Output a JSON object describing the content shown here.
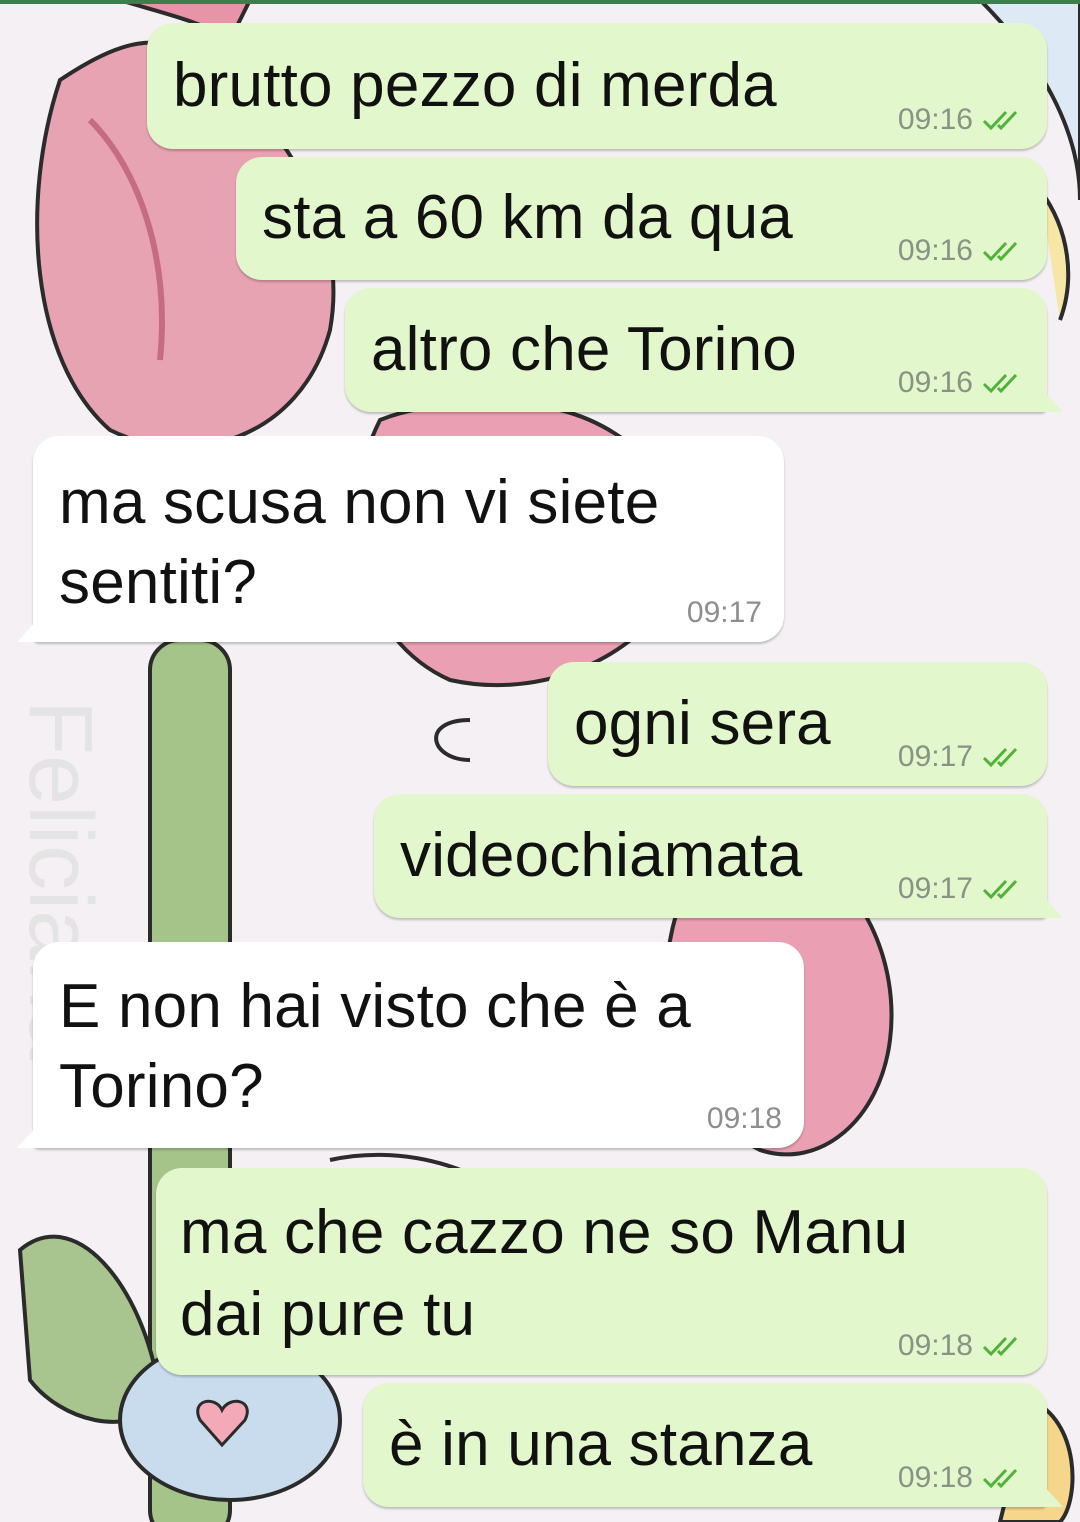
{
  "colors": {
    "outgoing_bubble": "#e2f7cb",
    "incoming_bubble": "#ffffff",
    "read_ticks": "#4fb33a",
    "timestamp": "#8a9287",
    "header_accent": "#3d7e4d"
  },
  "wallpaper": {
    "motif": "pink-tulips-and-blue-flowers",
    "watermark_text": "Feliciana"
  },
  "messages": [
    {
      "direction": "out",
      "text": "brutto pezzo di merda",
      "time": "09:16",
      "status_icon": "double-check-read-icon"
    },
    {
      "direction": "out",
      "text": "sta a 60 km da qua",
      "time": "09:16",
      "status_icon": "double-check-read-icon"
    },
    {
      "direction": "out",
      "text": "altro che Torino",
      "time": "09:16",
      "status_icon": "double-check-read-icon"
    },
    {
      "direction": "in",
      "lines": [
        "ma scusa non vi siete",
        "sentiti?"
      ],
      "time": "09:17"
    },
    {
      "direction": "out",
      "text": "ogni sera",
      "time": "09:17",
      "status_icon": "double-check-read-icon"
    },
    {
      "direction": "out",
      "text": "videochiamata",
      "time": "09:17",
      "status_icon": "double-check-read-icon"
    },
    {
      "direction": "in",
      "lines": [
        "E non hai visto che è a",
        "Torino?"
      ],
      "time": "09:18"
    },
    {
      "direction": "out",
      "lines": [
        "ma che cazzo ne so Manu",
        "dai pure tu"
      ],
      "time": "09:18",
      "status_icon": "double-check-read-icon"
    },
    {
      "direction": "out",
      "text": "è in una stanza",
      "time": "09:18",
      "status_icon": "double-check-read-icon"
    }
  ]
}
